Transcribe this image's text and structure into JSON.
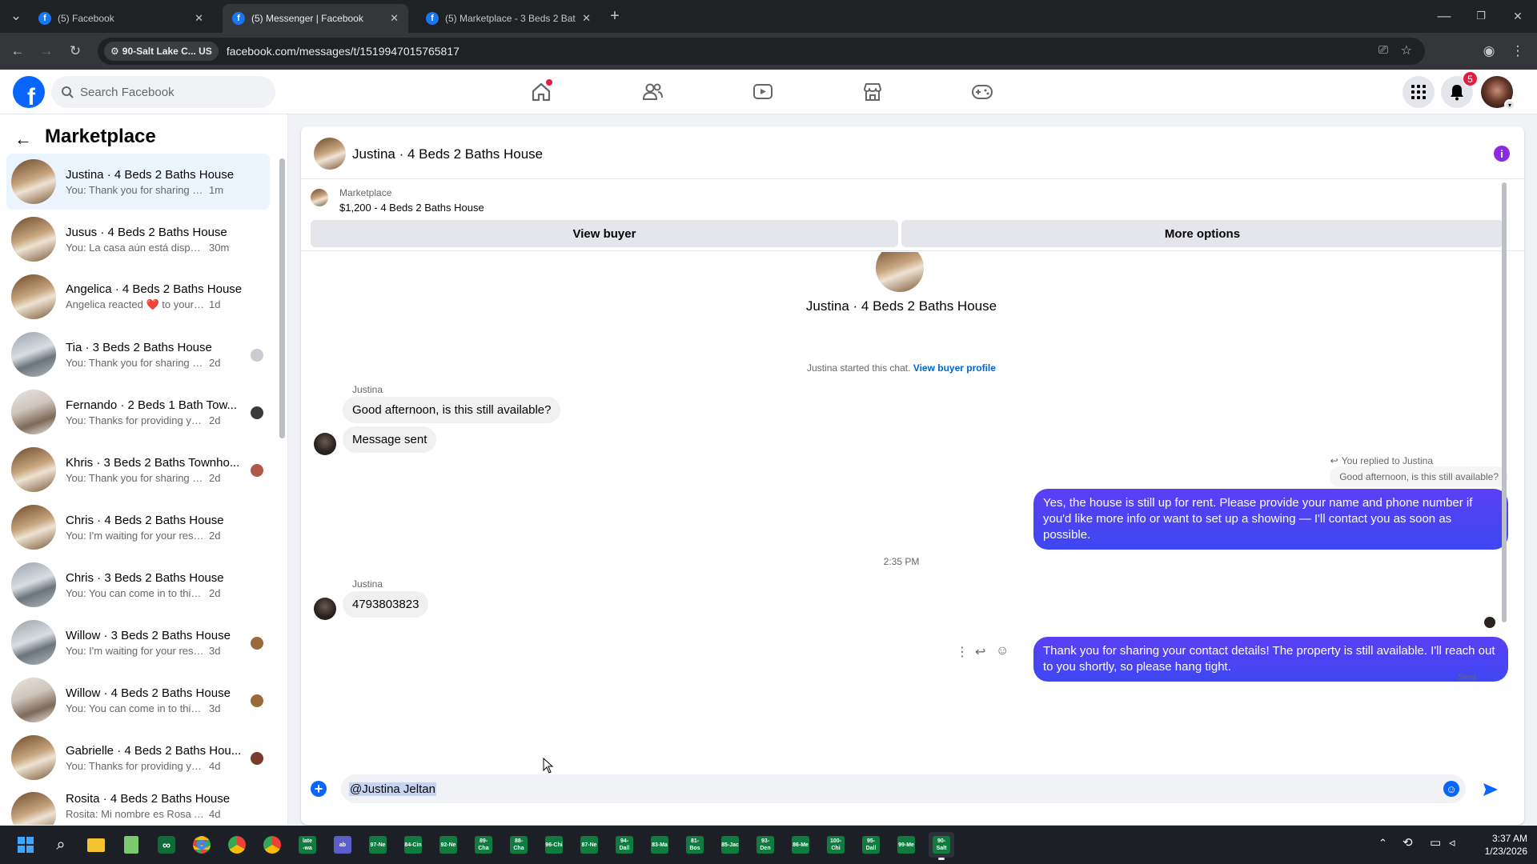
{
  "browser": {
    "tabs": [
      {
        "title": "(5) Facebook",
        "active": false
      },
      {
        "title": "(5) Messenger | Facebook",
        "active": true
      },
      {
        "title": "(5) Marketplace - 3 Beds 2 Bath",
        "active": false
      }
    ],
    "site_chip": "90-Salt Lake C... US",
    "url": "facebook.com/messages/t/1519947015765817"
  },
  "fb_header": {
    "logo": "f",
    "search_placeholder": "Search Facebook",
    "notification_count": "5",
    "nav_icons": [
      "home-icon",
      "friends-icon",
      "video-icon",
      "marketplace-icon",
      "gaming-icon"
    ]
  },
  "sidebar": {
    "title": "Marketplace",
    "conversations": [
      {
        "name": "Justina · 4 Beds 2 Baths House",
        "preview": "You: Thank you for sharing your co...",
        "time": "1m",
        "active": true
      },
      {
        "name": "Jusus · 4 Beds 2 Baths House",
        "preview": "You: La casa aún está disponible ...",
        "time": "30m"
      },
      {
        "name": "Angelica · 4 Beds 2 Baths House",
        "preview": "Angelica reacted ❤️ to your messa...",
        "time": "1d"
      },
      {
        "name": "Tia · 3 Beds 2 Baths House",
        "preview": "You: Thank you for sharing your ...",
        "time": "2d"
      },
      {
        "name": "Fernando · 2 Beds 1 Bath Tow...",
        "preview": "You: Thanks for providing your i...",
        "time": "2d"
      },
      {
        "name": "Khris · 3 Beds 2 Baths Townho...",
        "preview": "You: Thank you for sharing your ...",
        "time": "2d"
      },
      {
        "name": "Chris · 4 Beds 2 Baths House",
        "preview": "You: I'm waiting for your response. ...",
        "time": "2d"
      },
      {
        "name": "Chris · 3 Beds 2 Baths House",
        "preview": "You: You can come in to this place f...",
        "time": "2d"
      },
      {
        "name": "Willow · 3 Beds 2 Baths House",
        "preview": "You: I'm waiting for your respons...",
        "time": "3d"
      },
      {
        "name": "Willow · 4 Beds 2 Baths House",
        "preview": "You: You can come in to this plac...",
        "time": "3d"
      },
      {
        "name": "Gabrielle · 4 Beds 2 Baths Hou...",
        "preview": "You: Thanks for providing your i...",
        "time": "4d"
      },
      {
        "name": "Rosita · 4 Beds 2 Baths House",
        "preview": "Rosita: Mi nombre es Rosa Avelar...",
        "time": "4d"
      }
    ]
  },
  "chat": {
    "header_title": "Justina · 4 Beds 2 Baths House",
    "listing_label": "Marketplace",
    "listing_price": "$1,200 - 4 Beds 2 Baths House",
    "view_buyer": "View buyer",
    "more_options": "More options",
    "intro_title": "Justina · 4 Beds 2 Baths House",
    "started_text": "Justina started this chat.",
    "view_buyer_profile": "View buyer profile",
    "sender_label_1": "Justina",
    "msg_in_1": "Good afternoon, is this still available?",
    "msg_in_2": "Message sent",
    "replied_label": "You replied to Justina",
    "quoted": "Good afternoon, is this still available?",
    "msg_out_1": "Yes, the house is still up for rent. Please provide your name and phone number if you'd like more info or want to set up a showing — I'll contact you as soon as possible.",
    "timestamp": "2:35 PM",
    "sender_label_2": "Justina",
    "msg_in_3": "4793803823",
    "msg_out_2": "Thank you for sharing your contact details! The property is still available. I'll reach out to you shortly, so please hang tight.",
    "sent_status": "Sent",
    "composer_value": "@Justina Jeltan"
  },
  "taskbar": {
    "apps": [
      "97-Ne",
      "84-Cin",
      "92-Ne",
      "89-Cha",
      "88-Cha",
      "96-Chi",
      "87-Ne",
      "94-Dall",
      "83-Ma",
      "81-Bos",
      "85-Jac",
      "93-Den",
      "86-Me",
      "100-Chi",
      "95-Dall",
      "99-Me",
      "90-Salt"
    ],
    "time": "3:37 AM",
    "date": "1/23/2026"
  }
}
